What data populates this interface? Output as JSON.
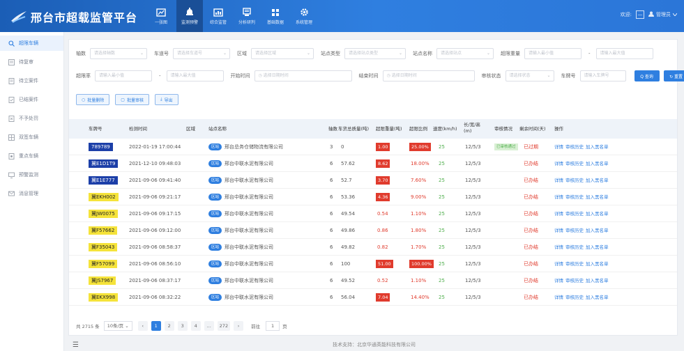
{
  "app": {
    "title": "邢台市超载监管平台"
  },
  "nav": [
    {
      "label": "一张图",
      "icon": "map-icon"
    },
    {
      "label": "监测预警",
      "icon": "alarm-bell-icon"
    },
    {
      "label": "综合监管",
      "icon": "chart-icon"
    },
    {
      "label": "分析研判",
      "icon": "monitor-icon"
    },
    {
      "label": "基础数据",
      "icon": "grid-icon"
    },
    {
      "label": "系统管理",
      "icon": "gear-icon"
    }
  ],
  "user": {
    "prefix": "欢迎:",
    "box_glyph": "—",
    "name": "管理员"
  },
  "sidebar": [
    {
      "label": "超限车辆"
    },
    {
      "label": "待复审"
    },
    {
      "label": "待立案件"
    },
    {
      "label": "已结案件"
    },
    {
      "label": "不予处罚"
    },
    {
      "label": "双签车辆"
    },
    {
      "label": "重点车辆"
    },
    {
      "label": "预警监测"
    },
    {
      "label": "消息管理"
    }
  ],
  "filters": {
    "row1": [
      {
        "label": "轴数",
        "placeholder": "请选择轴数"
      },
      {
        "label": "车道号",
        "placeholder": "请选择车道号"
      },
      {
        "label": "区域",
        "placeholder": "请选择区域"
      },
      {
        "label": "站点类型",
        "placeholder": "请选择站点类型"
      },
      {
        "label": "站点名称",
        "placeholder": "请选择站点"
      },
      {
        "label": "超限重量",
        "placeholder": "请输入最小值",
        "placeholder2": "请输入最大值"
      }
    ],
    "row2": {
      "rate_label": "超限率",
      "rate_min_placeholder": "请输入最小值",
      "rate_max_placeholder": "请输入最大值",
      "start_label": "开始时间",
      "start_placeholder": "选择日期时间",
      "end_label": "结束时间",
      "end_placeholder": "选择日期时间",
      "audit_label": "审核状态",
      "audit_placeholder": "请选择状态",
      "plate_label": "车牌号",
      "plate_placeholder": "请输入车牌号",
      "search_label": "Q 查询",
      "reset_label": "↻ 重置"
    }
  },
  "actions": {
    "batch_label": "批量删除",
    "audit_label": "批量审核",
    "export_label": "导出"
  },
  "table": {
    "headers": {
      "plate": "车牌号",
      "time": "检测时间",
      "area": "区域",
      "site": "站点名称",
      "axles": "轴数",
      "total": "车货总质量(吨)",
      "limit": "超限重量(吨)",
      "rate": "超限比例",
      "speed": "速度(km/h)",
      "size": "长/宽/高(m)",
      "audit": "审核情况",
      "days": "剩余时间(天)",
      "ops": "操作"
    },
    "site_tag": "区站",
    "ops": [
      "详情",
      "审核历史",
      "加入黑名单"
    ],
    "rows": [
      {
        "plate": "789789",
        "plate_color": "blue",
        "time": "2022-01-19 17:00:44",
        "site": "邢台总务仓储物流有限公司",
        "axles": "3",
        "total": "0",
        "limit": "1.00",
        "limit_box": true,
        "rate": "25.00%",
        "rate_box": true,
        "speed": "25",
        "size": "12/5/3",
        "audit": "已审核通过",
        "days": "已过期"
      },
      {
        "plate": "冀E1D1T9",
        "plate_color": "blue",
        "time": "2021-12-10 09:48:03",
        "site": "邢台中联水泥有限公司",
        "axles": "6",
        "total": "57.62",
        "limit": "8.62",
        "limit_box": true,
        "rate": "18.00%",
        "rate_box": false,
        "speed": "25",
        "size": "12/5/3",
        "audit": "",
        "days": "已办结"
      },
      {
        "plate": "冀E1E777",
        "plate_color": "blue",
        "time": "2021-09-06 09:41:40",
        "site": "邢台中联水泥有限公司",
        "axles": "6",
        "total": "52.7",
        "limit": "3.70",
        "limit_box": true,
        "rate": "7.60%",
        "rate_box": false,
        "speed": "25",
        "size": "12/5/3",
        "audit": "",
        "days": "已办结"
      },
      {
        "plate": "冀EKH002",
        "plate_color": "yellow",
        "time": "2021-09-06 09:21:17",
        "site": "邢台中联水泥有限公司",
        "axles": "6",
        "total": "53.36",
        "limit": "4.36",
        "limit_box": true,
        "rate": "9.00%",
        "rate_box": false,
        "speed": "25",
        "size": "12/5/3",
        "audit": "",
        "days": "已办结"
      },
      {
        "plate": "冀JW0075",
        "plate_color": "yellow",
        "time": "2021-09-06 09:17:15",
        "site": "邢台中联水泥有限公司",
        "axles": "6",
        "total": "49.54",
        "limit": "0.54",
        "limit_box": false,
        "rate": "1.10%",
        "rate_box": false,
        "speed": "25",
        "size": "12/5/3",
        "audit": "",
        "days": "已办结"
      },
      {
        "plate": "冀F57662",
        "plate_color": "yellow",
        "time": "2021-09-06 09:12:00",
        "site": "邢台中联水泥有限公司",
        "axles": "6",
        "total": "49.86",
        "limit": "0.86",
        "limit_box": false,
        "rate": "1.80%",
        "rate_box": false,
        "speed": "25",
        "size": "12/5/3",
        "audit": "",
        "days": "已办结"
      },
      {
        "plate": "冀F35043",
        "plate_color": "yellow",
        "time": "2021-09-06 08:58:37",
        "site": "邢台中联水泥有限公司",
        "axles": "6",
        "total": "49.82",
        "limit": "0.82",
        "limit_box": false,
        "rate": "1.70%",
        "rate_box": false,
        "speed": "25",
        "size": "12/5/3",
        "audit": "",
        "days": "已办结"
      },
      {
        "plate": "冀F57099",
        "plate_color": "yellow",
        "time": "2021-09-06 08:56:10",
        "site": "邢台中联水泥有限公司",
        "axles": "6",
        "total": "100",
        "limit": "51.00",
        "limit_box": true,
        "rate": "100.00%",
        "rate_box": true,
        "speed": "25",
        "size": "12/5/3",
        "audit": "",
        "days": "已办结"
      },
      {
        "plate": "冀JS7967",
        "plate_color": "yellow",
        "time": "2021-09-06 08:37:17",
        "site": "邢台中联水泥有限公司",
        "axles": "6",
        "total": "49.52",
        "limit": "0.52",
        "limit_box": false,
        "rate": "1.10%",
        "rate_box": false,
        "speed": "25",
        "size": "12/5/3",
        "audit": "",
        "days": "已办结"
      },
      {
        "plate": "冀EKX998",
        "plate_color": "yellow",
        "time": "2021-09-06 08:32:22",
        "site": "邢台中联水泥有限公司",
        "axles": "6",
        "total": "56.04",
        "limit": "7.04",
        "limit_box": true,
        "rate": "14.40%",
        "rate_box": false,
        "speed": "25",
        "size": "12/5/3",
        "audit": "",
        "days": "已办结"
      }
    ]
  },
  "pager": {
    "total": "共 2715 条",
    "size": "10条/页",
    "prev": "‹",
    "pages": [
      "1",
      "2",
      "3",
      "4",
      "…",
      "272"
    ],
    "next": "›",
    "goto_label": "前往",
    "goto_value": "1",
    "goto_suffix": "页"
  },
  "footer": {
    "support": "技术支持：北京华通英能科技有限公司",
    "menu": "☰"
  }
}
